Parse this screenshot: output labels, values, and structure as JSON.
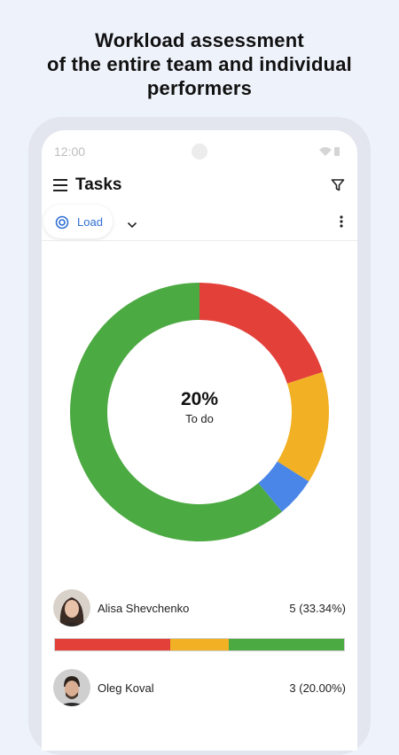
{
  "headline": {
    "line1": "Workload assessment",
    "line2": "of the entire team and individual",
    "line3": "performers"
  },
  "status_bar": {
    "time": "12:00"
  },
  "app_bar": {
    "title": "Tasks",
    "menu_icon": "hamburger-menu-icon",
    "filter_icon": "filter-icon"
  },
  "toolbar": {
    "chip_label": "Load",
    "chip_icon": "target-icon",
    "dropdown_icon": "chevron-down-icon",
    "more_icon": "more-vertical-icon"
  },
  "colors": {
    "red": "#e3403a",
    "yellow": "#f2b124",
    "blue": "#4a86e8",
    "green": "#4caa42",
    "accent": "#2f6fd6"
  },
  "chart_data": {
    "type": "pie",
    "center_value": "20%",
    "center_label": "To do",
    "slices": [
      {
        "color": "#e3403a",
        "value": 20
      },
      {
        "color": "#f2b124",
        "value": 14
      },
      {
        "color": "#4a86e8",
        "value": 5
      },
      {
        "color": "#4caa42",
        "value": 61
      }
    ]
  },
  "performers": [
    {
      "name": "Alisa Shevchenko",
      "count": "5 (33.34%)",
      "bar": [
        {
          "color": "#e3403a",
          "fraction": 0.4
        },
        {
          "color": "#f2b124",
          "fraction": 0.2
        },
        {
          "color": "#4caa42",
          "fraction": 0.4
        }
      ]
    },
    {
      "name": "Oleg Koval",
      "count": "3 (20.00%)"
    }
  ]
}
